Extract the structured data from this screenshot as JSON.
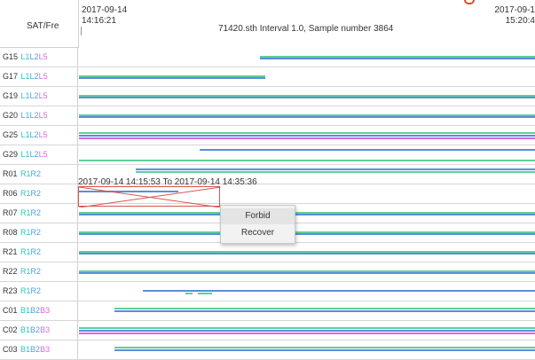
{
  "header": {
    "column_title": "SAT/Fre",
    "start_date": "2017-09-14",
    "start_time": "14:16:21",
    "end_date": "2017-09-1",
    "end_time": "15:20:4",
    "file_info": "71420.sth Interval 1.0, Sample number 3864"
  },
  "colors": {
    "L1": "#2ec4b6",
    "L2": "#4aa3df",
    "L5": "#d66bd9",
    "R1": "#2ec4b6",
    "R2": "#4aa3df",
    "B1": "#2ec4b6",
    "B2": "#4aa3df",
    "B3": "#d66bd9",
    "track_green": "#5fcf9a",
    "track_blue": "#5b8de0",
    "track_pink": "#d66bd9",
    "selection_border": "#d9534f"
  },
  "rows": [
    {
      "sat": "G15",
      "signals": [
        "L1",
        "L2",
        "L5"
      ]
    },
    {
      "sat": "G17",
      "signals": [
        "L1",
        "L2",
        "L5"
      ]
    },
    {
      "sat": "G19",
      "signals": [
        "L1",
        "L2",
        "L5"
      ]
    },
    {
      "sat": "G20",
      "signals": [
        "L1",
        "L2",
        "L5"
      ]
    },
    {
      "sat": "G25",
      "signals": [
        "L1",
        "L2",
        "L5"
      ]
    },
    {
      "sat": "G29",
      "signals": [
        "L1",
        "L2",
        "L5"
      ]
    },
    {
      "sat": "R01",
      "signals": [
        "R1",
        "R2"
      ]
    },
    {
      "sat": "R06",
      "signals": [
        "R1",
        "R2"
      ]
    },
    {
      "sat": "R07",
      "signals": [
        "R1",
        "R2"
      ]
    },
    {
      "sat": "R08",
      "signals": [
        "R1",
        "R2"
      ]
    },
    {
      "sat": "R21",
      "signals": [
        "R1",
        "R2"
      ]
    },
    {
      "sat": "R22",
      "signals": [
        "R1",
        "R2"
      ]
    },
    {
      "sat": "R23",
      "signals": [
        "R1",
        "R2"
      ]
    },
    {
      "sat": "C01",
      "signals": [
        "B1",
        "B2",
        "B3"
      ]
    },
    {
      "sat": "C02",
      "signals": [
        "B1",
        "B2",
        "B3"
      ]
    },
    {
      "sat": "C03",
      "signals": [
        "B1",
        "B2",
        "B3"
      ]
    }
  ],
  "selection": {
    "range_text": "2017-09-14 14:15:53 To 2017-09-14 14:35:36"
  },
  "context_menu": {
    "forbid": "Forbid",
    "recover": "Recover"
  }
}
